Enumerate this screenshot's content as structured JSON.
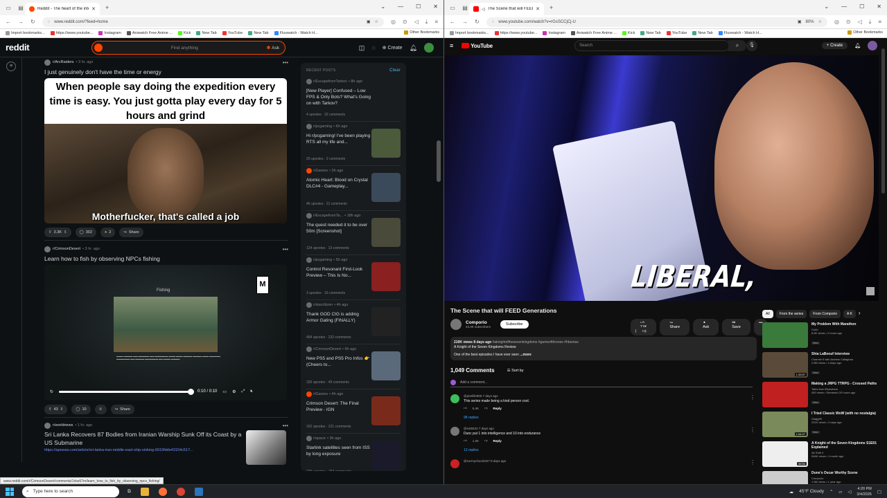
{
  "left_browser": {
    "tab_title": "Reddit - The heart of the intern",
    "url": "www.reddit.com/?feed=home",
    "bookmarks": [
      "Import bookmarks...",
      "https://www.youtube...",
      "Instagram",
      "Aniwatch Free Anime ...",
      "Kick",
      "New Tab",
      "YouTube",
      "New Tab",
      "Fluxwatch - Watch H..."
    ],
    "other_bookmarks": "Other Bookmarks",
    "status_url": "www.reddit.com/r/CrimsonDesert/comments/1rkw57m/learn_how_to_fish_by_observing_npcs_fishing/"
  },
  "reddit": {
    "logo": "reddit",
    "search_placeholder": "Find anything",
    "ask_label": "Ask",
    "create_label": "Create",
    "post1": {
      "subreddit": "r/ArcRaiders",
      "time": "• 3 hr. ago",
      "title": "I just genuinely don't have the time or energy",
      "meme_top": "When people say doing the expedition every time is easy. You just gotta play every day for 5 hours and grind",
      "meme_caption": "Motherfucker, that's called a job",
      "votes": "3.3K",
      "comments": "302",
      "awards": "2",
      "share": "Share"
    },
    "post2": {
      "subreddit": "r/CrimsonDesert",
      "time": "• 3 hr. ago",
      "title": "Learn how to fish by observing NPCs fishing",
      "video_heading": "Fishing",
      "video_time": "0:10 / 0:10",
      "esrb": "M",
      "votes": "43",
      "comments": "10",
      "share": "Share"
    },
    "post3": {
      "subreddit": "r/worldnews",
      "time": "• 1 hr. ago",
      "title": "Sri Lanka Recovers 87 Bodies from Iranian Warship Sunk Off its Coast by a US Submarine",
      "link": "https://apnews.com/article/sri-lanka-iran-middle-east-ship-sinking-6919fdde43154c517..."
    },
    "recent": {
      "heading": "RECENT POSTS",
      "clear": "Clear",
      "items": [
        {
          "sub": "r/EscapefromTarkov",
          "time": "• 8h ago",
          "title": "[New Player] Confused – Low FPS & Only Bots? What's Going on with Tarkov?",
          "stats": "4 upvotes · 32 comments",
          "color": "#6b6b6b",
          "thumb": ""
        },
        {
          "sub": "r/pcgaming",
          "time": "• 6h ago",
          "title": "Hi r/pcgaming! I've been playing RTS all my life and...",
          "stats": "20 upvotes · 2 comments",
          "color": "#6b6b6b",
          "thumb": "#4a5a3a"
        },
        {
          "sub": "r/Games",
          "time": "• 3h ago",
          "title": "Atomic Heart: Blood on Crystal DLC#4 - Gameplay...",
          "stats": "46 upvotes · 21 comments",
          "color": "#ff4500",
          "thumb": "#3a4a5a"
        },
        {
          "sub": "r/EscapefromTa...",
          "time": "• 18h ago",
          "title": "The quest needed it to be over 50m [Screenshot]",
          "stats": "124 upvotes · 13 comments",
          "color": "#6b6b6b",
          "thumb": "#4a4a3a"
        },
        {
          "sub": "r/pcgaming",
          "time": "• 5h ago",
          "title": "Control Resonant First-Look Preview – This Is No...",
          "stats": "3 upvotes · 16 comments",
          "color": "#6b6b6b",
          "thumb": "#8a2020"
        },
        {
          "sub": "r/starcitizen",
          "time": "• 4h ago",
          "title": "Thank GOD CIG is adding Armor Gating (FINALLY)",
          "stats": "494 upvotes · 232 comments",
          "color": "#6b6b6b",
          "thumb": "#222222"
        },
        {
          "sub": "r/CrimsonDesert",
          "time": "• 6h ago",
          "title": "New PS5 and PS5 Pro Infos 👉 (Cheers to...",
          "stats": "150 upvotes · 49 comments",
          "color": "#6b6b6b",
          "thumb": "#5a6a7a"
        },
        {
          "sub": "r/Games",
          "time": "• 4h ago",
          "title": "Crimson Desert: The Final Preview - IGN",
          "stats": "162 upvotes · 121 comments",
          "color": "#ff4500",
          "thumb": "#7a2a1a"
        },
        {
          "sub": "r/space",
          "time": "• 3h ago",
          "title": "Starlink satellites seen from ISS by long exposure",
          "stats": "24K upvotes · 464 comments",
          "color": "#6b6b6b",
          "thumb": "#1a1a2a"
        }
      ]
    }
  },
  "right_browser": {
    "tab_title": "The Scene that will FEED G...",
    "url": "www.youtube.com/watch?v=rGsSCCjCj-U",
    "zoom": "80%",
    "bookmarks": [
      "Import bookmarks...",
      "https://www.youtube...",
      "Instagram",
      "Aniwatch Free Anime ...",
      "Kick",
      "New Tab",
      "YouTube",
      "New Tab",
      "Fluxwatch - Watch H..."
    ],
    "other_bookmarks": "Other Bookmarks"
  },
  "youtube": {
    "logo": "YouTube",
    "search_placeholder": "Search",
    "create_label": "Create",
    "video_caption": "LIBERAL,",
    "title": "The Scene that will FEED Generations",
    "channel": "Comporio",
    "subscribers": "43.3K subscribers",
    "subscribe": "Subscribe",
    "likes": "11K",
    "share": "Share",
    "ask": "Ask",
    "save": "Save",
    "desc_stats": "219K views  8 days ago",
    "desc_tags": "#aknightofthesevenkingdoms #gameofthrones #hbomax",
    "desc_line1": "A Knight of the Seven Kingdoms Review",
    "desc_line2": "One of the best episodes I have ever seen",
    "desc_more": "...more",
    "comments_count": "1,049 Comments",
    "sort_by": "Sort by",
    "add_comment": "Add a comment...",
    "comments": [
      {
        "user": "@peeliife900",
        "time": "7 days ago",
        "text": "This series made being a kind person cool.",
        "likes": "5.4K",
        "replies": "98 replies",
        "color": "#3cbf5a"
      },
      {
        "user": "@sottt422",
        "time": "7 days ago",
        "text": "Dunc put 1 into intelligence and 10 into endurance",
        "likes": "1.2K",
        "replies": "13 replies",
        "color": "#777777"
      },
      {
        "user": "@sorrnychuol4327",
        "time": "8 days ago",
        "text": "",
        "likes": "",
        "replies": "",
        "color": "#cc2222"
      }
    ],
    "chips": [
      "All",
      "From the series",
      "From Comporio",
      "A K"
    ],
    "recs": [
      {
        "title": "My Problem With Marathon",
        "channel": "Cohh",
        "meta": "8.6K views • 2 hours ago",
        "badge": "New",
        "duration": "",
        "color": "#3a7a3a"
      },
      {
        "title": "Shia LaBeouf Interview",
        "channel": "Channel 5 with Andrew Callaghan",
        "meta": "2.8M views • 4 days ago",
        "badge": "New",
        "duration": "1:33:57",
        "color": "#5a4a3a"
      },
      {
        "title": "Making a JRPG TTRPG - Crossed Paths",
        "channel": "Tales from Elsewhere",
        "meta": "450 views • Streamed 20 hours ago",
        "badge": "New",
        "duration": "",
        "color": "#c02020"
      },
      {
        "title": "I Tried Classic WoW (with no nostalgia)",
        "channel": "Stagg99",
        "meta": "231K views • 4 days ago",
        "badge": "New",
        "duration": "1:04:27",
        "color": "#7a8a5a"
      },
      {
        "title": "A Knight of the Seven Kingdoms S1E01 Explained",
        "channel": "Alt Shift X",
        "meta": "946K views • 1 month ago",
        "badge": "",
        "duration": "32:31",
        "color": "#eeeeee"
      },
      {
        "title": "Dune's Oscar Worthy Scene",
        "channel": "Comporio",
        "meta": "1.5M views • 1 year ago",
        "badge": "",
        "duration": "",
        "color": "#cccccc"
      }
    ]
  },
  "taskbar": {
    "search_placeholder": "Type here to search",
    "weather": "45°F  Cloudy",
    "time": "4:20 PM",
    "date": "3/4/2026"
  }
}
